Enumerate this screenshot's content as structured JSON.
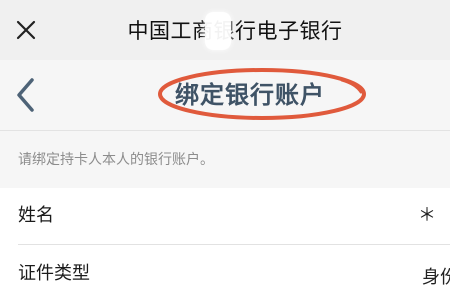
{
  "top_bar": {
    "close_icon": "close-icon",
    "title": "中国工商银行电子银行"
  },
  "nav_bar": {
    "back_icon": "chevron-left-icon",
    "page_title": "绑定银行账户",
    "highlight_color": "#e05a3c"
  },
  "hint": {
    "text": "请绑定持卡人本人的银行账户。"
  },
  "form": {
    "name": {
      "label": "姓名",
      "value": "＊"
    },
    "id_type": {
      "label": "证件类型",
      "value": "身份证"
    }
  },
  "colors": {
    "top_bar_bg": "#f0f0f0",
    "nav_bg": "#f6f6f6",
    "title_color": "#3f5366",
    "back_icon_color": "#4e6377",
    "hint_color": "#8c8c8c"
  }
}
